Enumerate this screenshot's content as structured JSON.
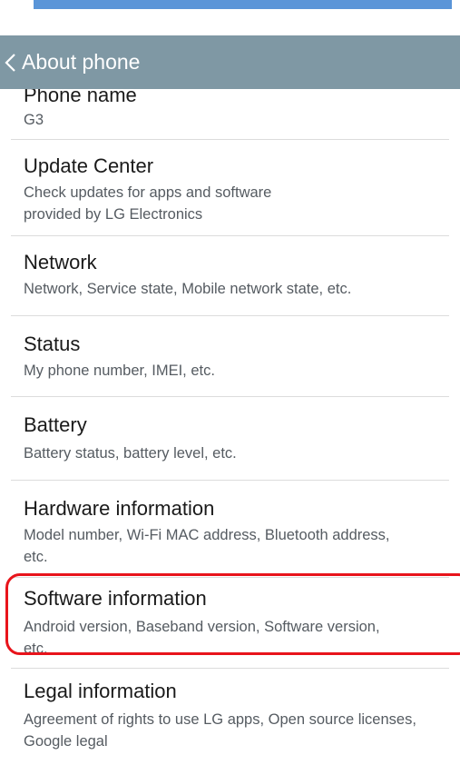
{
  "action_bar": {
    "title": "About phone"
  },
  "items": [
    {
      "title": "Phone name",
      "subtitle": "G3"
    },
    {
      "title": "Update Center",
      "subtitle": "Check updates for apps and software provided by LG Electronics"
    },
    {
      "title": "Network",
      "subtitle": "Network, Service state, Mobile network state, etc."
    },
    {
      "title": "Status",
      "subtitle": "My phone number, IMEI, etc."
    },
    {
      "title": "Battery",
      "subtitle": "Battery status, battery level, etc."
    },
    {
      "title": "Hardware information",
      "subtitle": "Model number, Wi-Fi MAC address, Bluetooth address, etc."
    },
    {
      "title": "Software information",
      "subtitle": "Android version, Baseband version, Software version, etc."
    },
    {
      "title": "Legal information",
      "subtitle": "Agreement of rights to use LG apps, Open source licenses, Google legal"
    }
  ],
  "colors": {
    "action_bar": "#7f98a4",
    "top_strip": "#5a95d8",
    "highlight": "#e8141b"
  }
}
